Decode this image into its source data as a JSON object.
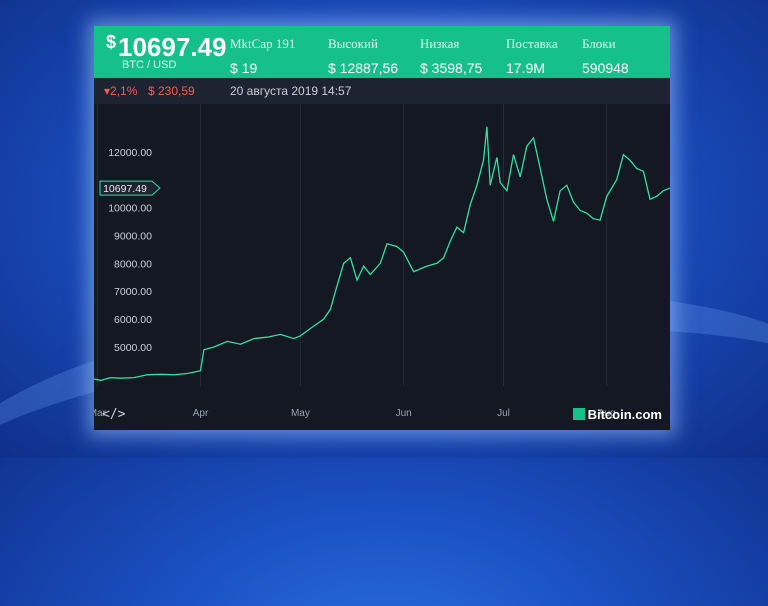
{
  "header": {
    "price_symbol": "$",
    "price": "10697.49",
    "pair": "BTC / USD",
    "stats": [
      {
        "label": "MktCap 191",
        "value": "$ 19"
      },
      {
        "label": "Высокий",
        "value": "$ 12887,56"
      },
      {
        "label": "Низкая",
        "value": "$ 3598,75"
      },
      {
        "label": "Поставка",
        "value": "17.9M"
      },
      {
        "label": "Блоки",
        "value": "590948"
      }
    ]
  },
  "subbar": {
    "change_pct": "▾2,1%",
    "change_abs": "$ 230,59",
    "datetime": "20 августа 2019 14:57"
  },
  "footer": {
    "embed_label": "</>",
    "brand": "Bitcoin.com"
  },
  "colors": {
    "header_bg": "#16c08a",
    "line": "#33e0a0",
    "negative": "#ff5a4a"
  },
  "chart_data": {
    "type": "line",
    "current_value_label": "10697.49",
    "current_value": 10697.49,
    "ylim": [
      3600,
      13500
    ],
    "yticks": [
      5000,
      6000,
      7000,
      8000,
      9000,
      10000,
      12000
    ],
    "ytick_labels": [
      "5000.00",
      "6000.00",
      "7000.00",
      "8000.00",
      "9000.00",
      "10000.00",
      "12000.00"
    ],
    "xlim": [
      "2019-02-28",
      "2019-08-20"
    ],
    "xticks": [
      {
        "date": "2019-03-01",
        "label": "Mar"
      },
      {
        "date": "2019-04-01",
        "label": "Apr"
      },
      {
        "date": "2019-05-01",
        "label": "May"
      },
      {
        "date": "2019-06-01",
        "label": "Jun"
      },
      {
        "date": "2019-07-01",
        "label": "Jul"
      },
      {
        "date": "2019-08-01",
        "label": "Aug"
      }
    ],
    "series": [
      {
        "values": [
          [
            "2019-02-28",
            3850
          ],
          [
            "2019-03-02",
            3800
          ],
          [
            "2019-03-05",
            3900
          ],
          [
            "2019-03-08",
            3880
          ],
          [
            "2019-03-12",
            3900
          ],
          [
            "2019-03-16",
            4000
          ],
          [
            "2019-03-20",
            4020
          ],
          [
            "2019-03-24",
            4000
          ],
          [
            "2019-03-28",
            4050
          ],
          [
            "2019-04-01",
            4150
          ],
          [
            "2019-04-02",
            4900
          ],
          [
            "2019-04-05",
            5000
          ],
          [
            "2019-04-09",
            5200
          ],
          [
            "2019-04-13",
            5100
          ],
          [
            "2019-04-17",
            5300
          ],
          [
            "2019-04-21",
            5350
          ],
          [
            "2019-04-25",
            5450
          ],
          [
            "2019-04-29",
            5300
          ],
          [
            "2019-05-01",
            5400
          ],
          [
            "2019-05-05",
            5750
          ],
          [
            "2019-05-08",
            6000
          ],
          [
            "2019-05-10",
            6350
          ],
          [
            "2019-05-12",
            7200
          ],
          [
            "2019-05-14",
            8000
          ],
          [
            "2019-05-16",
            8200
          ],
          [
            "2019-05-18",
            7400
          ],
          [
            "2019-05-20",
            7900
          ],
          [
            "2019-05-22",
            7600
          ],
          [
            "2019-05-25",
            8000
          ],
          [
            "2019-05-27",
            8700
          ],
          [
            "2019-05-30",
            8600
          ],
          [
            "2019-06-01",
            8400
          ],
          [
            "2019-06-04",
            7700
          ],
          [
            "2019-06-06",
            7800
          ],
          [
            "2019-06-08",
            7900
          ],
          [
            "2019-06-11",
            8000
          ],
          [
            "2019-06-13",
            8200
          ],
          [
            "2019-06-15",
            8800
          ],
          [
            "2019-06-17",
            9300
          ],
          [
            "2019-06-19",
            9100
          ],
          [
            "2019-06-21",
            10100
          ],
          [
            "2019-06-23",
            10800
          ],
          [
            "2019-06-25",
            11700
          ],
          [
            "2019-06-26",
            12900
          ],
          [
            "2019-06-27",
            10800
          ],
          [
            "2019-06-28",
            11300
          ],
          [
            "2019-06-29",
            11800
          ],
          [
            "2019-06-30",
            10900
          ],
          [
            "2019-07-02",
            10600
          ],
          [
            "2019-07-04",
            11900
          ],
          [
            "2019-07-06",
            11100
          ],
          [
            "2019-07-08",
            12200
          ],
          [
            "2019-07-10",
            12500
          ],
          [
            "2019-07-12",
            11400
          ],
          [
            "2019-07-14",
            10300
          ],
          [
            "2019-07-16",
            9500
          ],
          [
            "2019-07-18",
            10600
          ],
          [
            "2019-07-20",
            10800
          ],
          [
            "2019-07-22",
            10200
          ],
          [
            "2019-07-24",
            9900
          ],
          [
            "2019-07-26",
            9800
          ],
          [
            "2019-07-28",
            9600
          ],
          [
            "2019-07-30",
            9550
          ],
          [
            "2019-08-01",
            10400
          ],
          [
            "2019-08-04",
            11000
          ],
          [
            "2019-08-06",
            11900
          ],
          [
            "2019-08-08",
            11700
          ],
          [
            "2019-08-10",
            11400
          ],
          [
            "2019-08-12",
            11300
          ],
          [
            "2019-08-14",
            10300
          ],
          [
            "2019-08-16",
            10400
          ],
          [
            "2019-08-18",
            10600
          ],
          [
            "2019-08-20",
            10697.49
          ]
        ]
      }
    ],
    "grid": "vertical"
  }
}
